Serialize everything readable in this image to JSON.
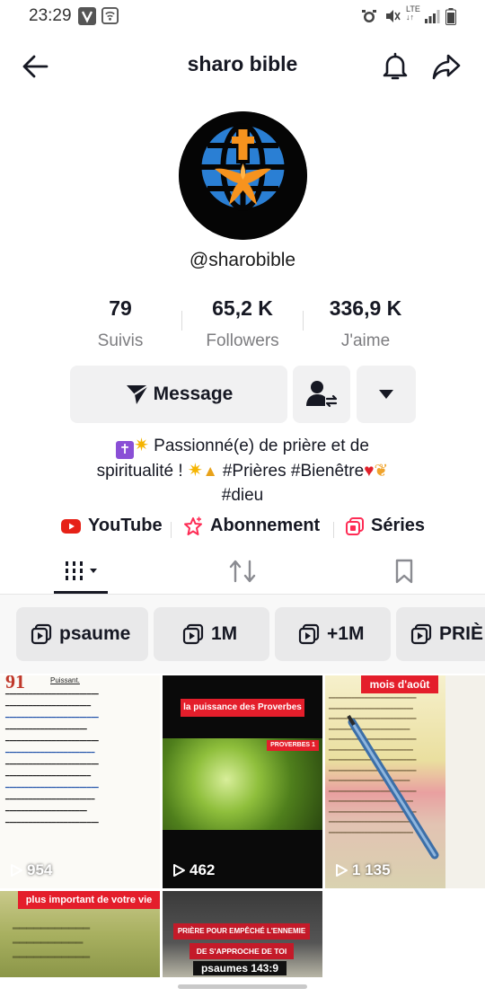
{
  "status_bar": {
    "time": "23:29",
    "network": "LTE"
  },
  "header": {
    "title": "sharo bible",
    "back_icon": "arrow-left-icon",
    "bell_icon": "bell-icon",
    "share_icon": "share-arrow-icon"
  },
  "profile": {
    "username": "@sharobible",
    "stats": [
      {
        "value": "79",
        "label": "Suivis"
      },
      {
        "value": "65,2 K",
        "label": "Followers"
      },
      {
        "value": "336,9 K",
        "label": "J'aime"
      }
    ],
    "message_label": "Message",
    "bio_line1": "Passionné(e) de prière et de",
    "bio_line2": "spiritualité !",
    "bio_tags": "#Prières #Bienêtre",
    "bio_line3": "#dieu"
  },
  "links": [
    {
      "label": "YouTube",
      "icon": "youtube-icon"
    },
    {
      "label": "Abonnement",
      "icon": "subscription-icon"
    },
    {
      "label": "Séries",
      "icon": "series-icon"
    }
  ],
  "tabs": [
    {
      "name": "videos",
      "icon": "grid-icon",
      "active": true
    },
    {
      "name": "reposts",
      "icon": "repost-icon",
      "active": false
    },
    {
      "name": "saved",
      "icon": "bookmark-icon",
      "active": false
    }
  ],
  "playlists": [
    {
      "label": "psaume"
    },
    {
      "label": "1M"
    },
    {
      "label": "+1M"
    },
    {
      "label": "PRIÈ"
    }
  ],
  "videos": [
    {
      "views": "954",
      "caption": "Puissant."
    },
    {
      "views": "462",
      "caption": "la puissance des Proverbes",
      "badge": "PROVERBES 1"
    },
    {
      "views": "1 135",
      "caption": "mois d'août"
    },
    {
      "views": "",
      "caption": "plus important de votre vie"
    },
    {
      "views": "",
      "caption": "PRIÈRE POUR EMPÊCHÉ L'ENNEMIE",
      "caption2": "DE S'APPROCHE DE TOI",
      "caption3": "psaumes 143:9"
    }
  ],
  "colors": {
    "accent_red": "#fe2c55",
    "youtube_red": "#e62117",
    "text": "#161823",
    "muted": "#7d7d80"
  }
}
